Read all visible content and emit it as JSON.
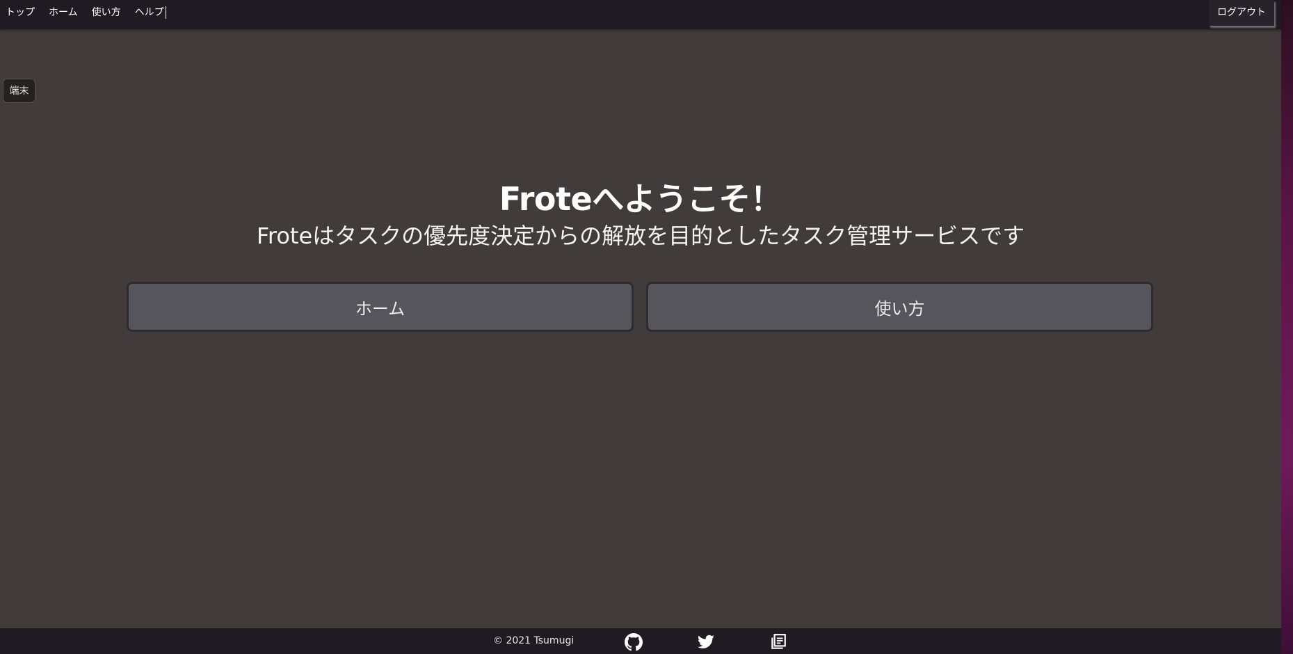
{
  "nav": {
    "items": [
      {
        "label": "トップ"
      },
      {
        "label": "ホーム"
      },
      {
        "label": "使い方"
      },
      {
        "label": "ヘルプ"
      }
    ],
    "logout_label": "ログアウト"
  },
  "terminal": {
    "label": "端末"
  },
  "hero": {
    "title": "Froteへようこそ！",
    "subtitle": "Froteはタスクの優先度決定からの解放を目的としたタスク管理サービスです"
  },
  "cta": {
    "home_label": "ホーム",
    "usage_label": "使い方"
  },
  "footer": {
    "copyright": "© 2021 Tsumugi",
    "icons": [
      "github-icon",
      "twitter-icon",
      "docs-icon"
    ]
  },
  "colors": {
    "background": "#413b3b",
    "bar": "#201b22",
    "button": "#56555b",
    "edge_gradient_mid": "#6e1a5a"
  }
}
